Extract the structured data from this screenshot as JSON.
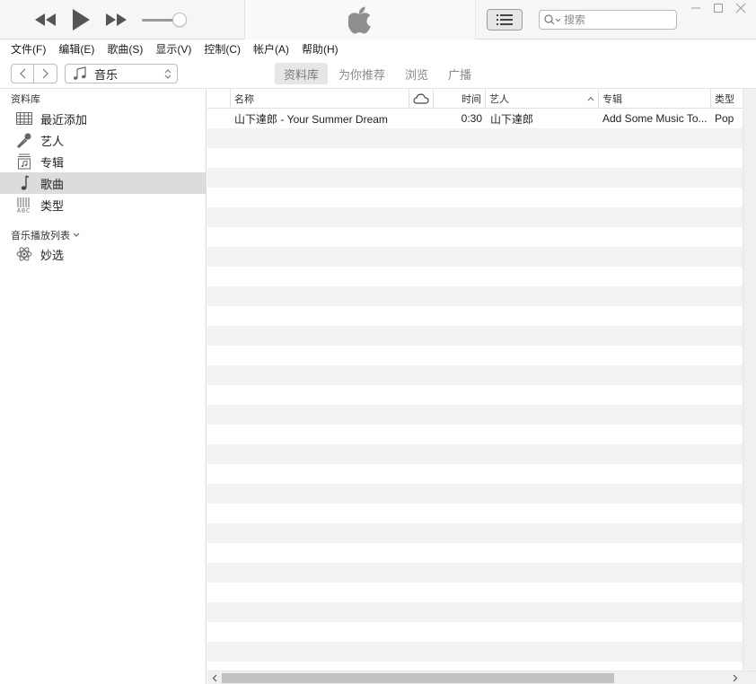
{
  "player": {
    "prev_icon": "rewind-icon",
    "play_icon": "play-icon",
    "next_icon": "fast-forward-icon",
    "volume": 0.75,
    "logo_icon": "apple-logo-icon",
    "list_icon": "list-view-icon",
    "search_placeholder": "搜索"
  },
  "menu": [
    "文件(F)",
    "编辑(E)",
    "歌曲(S)",
    "显示(V)",
    "控制(C)",
    "帐户(A)",
    "帮助(H)"
  ],
  "nav": {
    "media_label": "音乐",
    "tabs": [
      "资料库",
      "为你推荐",
      "浏览",
      "广播"
    ],
    "active_tab": "资料库"
  },
  "sidebar": {
    "library_header": "资料库",
    "items": [
      {
        "label": "最近添加",
        "icon": "recently-added-icon"
      },
      {
        "label": "艺人",
        "icon": "microphone-icon"
      },
      {
        "label": "专辑",
        "icon": "album-icon"
      },
      {
        "label": "歌曲",
        "icon": "music-note-icon"
      },
      {
        "label": "类型",
        "icon": "genres-icon"
      }
    ],
    "selected": "歌曲",
    "playlists_header": "音乐播放列表",
    "playlists": [
      {
        "label": "妙选",
        "icon": "genius-atom-icon"
      }
    ]
  },
  "table": {
    "columns": {
      "name": "名称",
      "cloud_icon": "cloud-icon",
      "time": "时间",
      "artist": "艺人",
      "album": "专辑",
      "genre": "类型"
    },
    "sort_column": "艺人",
    "rows": [
      {
        "name": "山下達郎 - Your Summer Dream",
        "time": "0:30",
        "artist": "山下達郎",
        "album": "Add Some Music To...",
        "genre": "Pop"
      }
    ]
  },
  "colors": {
    "selected_bg": "#dcdcdc",
    "stripe_bg": "#f2f2f2",
    "toolbar_bg": "#f6f6f6"
  }
}
